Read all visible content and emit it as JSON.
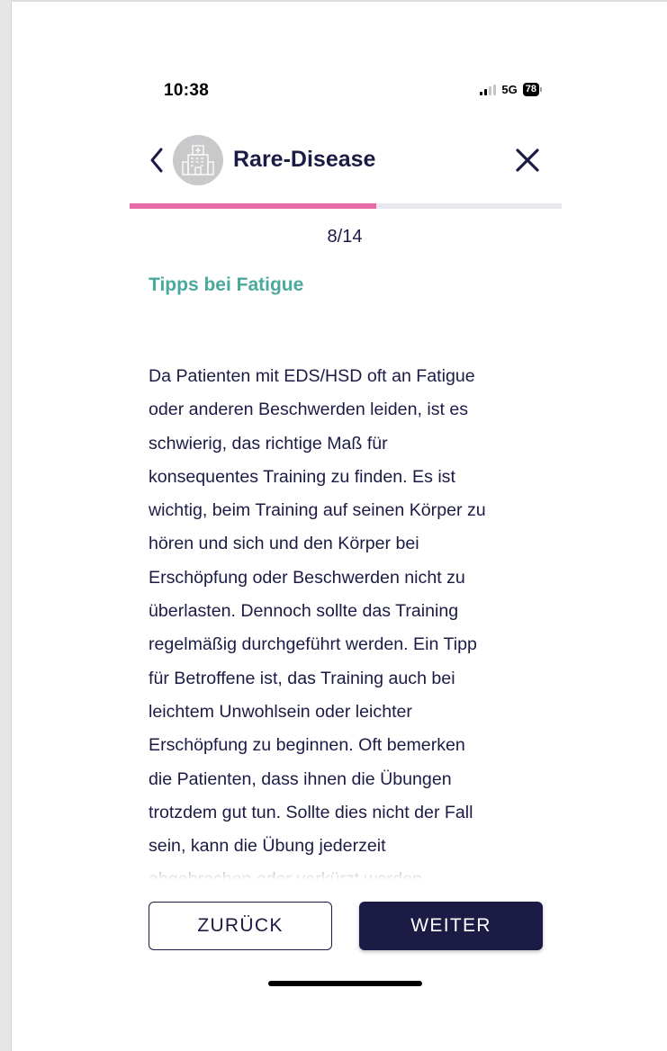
{
  "status_bar": {
    "time": "10:38",
    "network": "5G",
    "battery": "78"
  },
  "header": {
    "title": "Rare-Disease",
    "avatar_icon": "hospital-icon"
  },
  "progress": {
    "current": 8,
    "total": 14,
    "fraction": 0.5714,
    "label": "8/14",
    "fill_color": "#e66ba6",
    "track_color": "#e9e8ef"
  },
  "content": {
    "section_title": "Tipps bei Fatigue",
    "body_lines": [
      "Da Patienten mit EDS/HSD oft an Fatigue",
      "oder anderen Beschwerden leiden, ist es",
      "schwierig, das richtige Maß für",
      "konsequentes Training zu finden. Es ist",
      "wichtig, beim Training auf seinen Körper zu",
      "hören und sich und den Körper bei",
      "Erschöpfung oder Beschwerden nicht zu",
      "überlasten. Dennoch sollte das Training",
      "regelmäßig durchgeführt werden. Ein Tipp",
      "für Betroffene ist, das Training auch bei",
      "leichtem Unwohlsein oder leichter",
      "Erschöpfung zu beginnen. Oft bemerken",
      "die Patienten, dass ihnen die Übungen",
      "trotzdem gut tun. Sollte dies nicht der Fall",
      "sein, kann die Übung jederzeit",
      "abgebrochen oder verkürzt werden."
    ]
  },
  "buttons": {
    "back_label": "ZURÜCK",
    "next_label": "WEITER"
  },
  "colors": {
    "navy": "#1c1b45",
    "teal": "#4aa99b",
    "pink": "#e66ba6"
  }
}
